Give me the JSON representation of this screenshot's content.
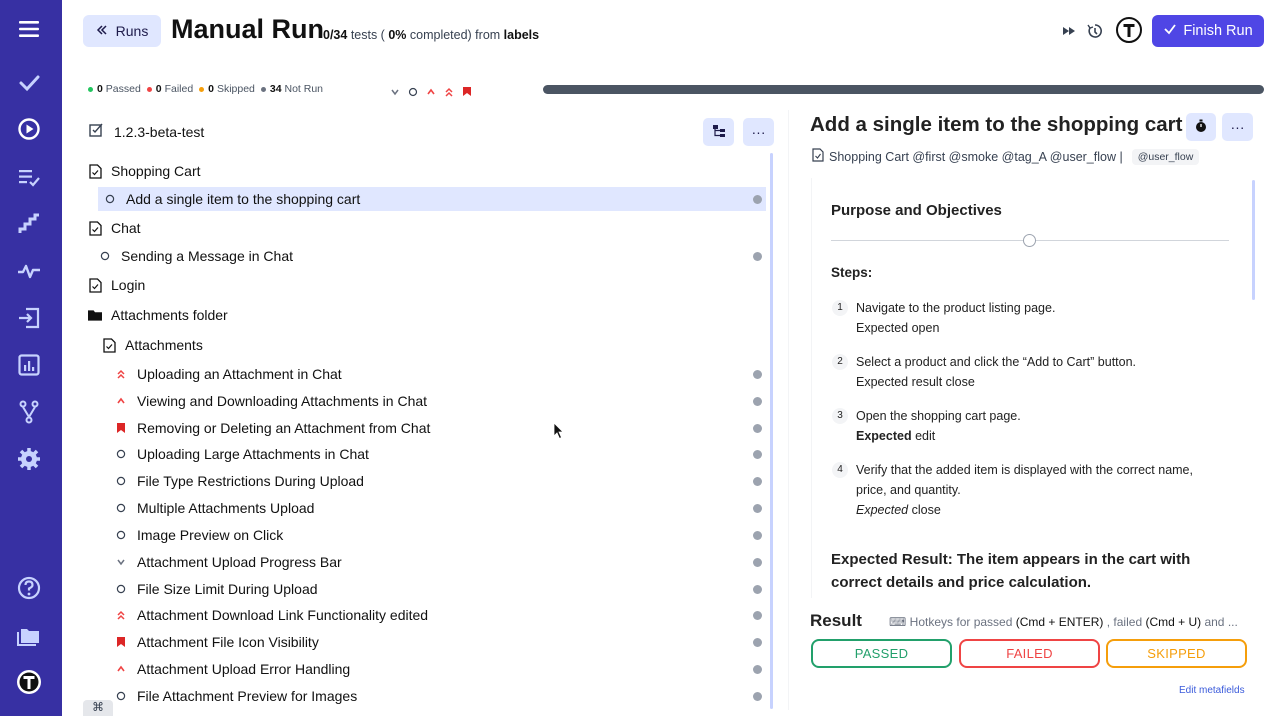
{
  "header": {
    "runs_label": "Runs",
    "title": "Manual Run",
    "subtitle_prefix": "0/34",
    "subtitle_mid": " tests ( ",
    "subtitle_pct": "0%",
    "subtitle_mid2": " completed) from ",
    "subtitle_source": "labels",
    "finish_label": "Finish Run",
    "accent": "#4f46e5"
  },
  "stats": {
    "passed_count": "0",
    "passed_label": "Passed",
    "failed_count": "0",
    "failed_label": "Failed",
    "skipped_count": "0",
    "skipped_label": "Skipped",
    "notrun_count": "34",
    "notrun_label": "Not Run",
    "colors": {
      "passed": "#22c55e",
      "failed": "#ef4444",
      "skipped": "#f59e0b",
      "notrun": "#6b7280"
    },
    "progress": 0
  },
  "tree": {
    "root_label": "1.2.3-beta-test",
    "items": [
      {
        "label": "Shopping Cart",
        "icon": "file-icon"
      },
      {
        "label": "Add a single item to the shopping cart",
        "icon": "circle-icon"
      },
      {
        "label": "Chat",
        "icon": "file-icon"
      },
      {
        "label": "Sending a Message in Chat",
        "icon": "circle-icon"
      },
      {
        "label": "Login",
        "icon": "file-icon"
      },
      {
        "label": "Attachments folder",
        "icon": "folder-icon"
      },
      {
        "label": "Attachments",
        "icon": "file-icon"
      },
      {
        "label": "Uploading an Attachment in Chat",
        "icon": "double-chevron-up-icon"
      },
      {
        "label": "Viewing and Downloading Attachments in Chat",
        "icon": "chevron-up-icon"
      },
      {
        "label": "Removing or Deleting an Attachment from Chat",
        "icon": "bookmark-icon"
      },
      {
        "label": "Uploading Large Attachments in Chat",
        "icon": "circle-icon"
      },
      {
        "label": "File Type Restrictions During Upload",
        "icon": "circle-icon"
      },
      {
        "label": "Multiple Attachments Upload",
        "icon": "circle-icon"
      },
      {
        "label": "Image Preview on Click",
        "icon": "circle-icon"
      },
      {
        "label": "Attachment Upload Progress Bar",
        "icon": "chevron-down-icon"
      },
      {
        "label": "File Size Limit During Upload",
        "icon": "circle-icon"
      },
      {
        "label": "Attachment Download Link Functionality edited",
        "icon": "double-chevron-up-icon"
      },
      {
        "label": "Attachment File Icon Visibility",
        "icon": "bookmark-icon"
      },
      {
        "label": "Attachment Upload Error Handling",
        "icon": "chevron-up-icon"
      },
      {
        "label": "File Attachment Preview for Images",
        "icon": "circle-icon"
      }
    ]
  },
  "detail": {
    "title": "Add a single item to the shopping cart",
    "tag_line": "Shopping Cart @first @smoke @tag_A @user_flow |",
    "tag_pill": "@user_flow",
    "section_title": "Purpose and Objectives",
    "steps_label": "Steps:",
    "steps": [
      {
        "num": "1",
        "line1": "Navigate to the product listing page.",
        "exp_prefix": "Expected",
        "exp_suffix": " open",
        "style": "plain"
      },
      {
        "num": "2",
        "line1": "Select a product and click the “Add to Cart” button.",
        "exp_prefix": "Expected",
        "exp_suffix": " result close",
        "style": "plain"
      },
      {
        "num": "3",
        "line1": "Open the shopping cart page.",
        "exp_prefix": "Expected",
        "exp_suffix": " edit",
        "style": "bold"
      },
      {
        "num": "4",
        "line1": "Verify that the added item is displayed with the correct name,",
        "line2": "price, and quantity.",
        "exp_prefix": "Expected",
        "exp_suffix": " close",
        "style": "italic"
      }
    ],
    "expected_label": "Expected Result:",
    "expected_text": " The item appears in the cart with correct details and price calculation."
  },
  "result": {
    "label": "Result",
    "hotkeys_a": "Hotkeys for passed ",
    "hotkeys_b": "(Cmd + ENTER)",
    "hotkeys_c": " , failed ",
    "hotkeys_d": "(Cmd + U)",
    "hotkeys_e": " and ...",
    "passed": "PASSED",
    "failed": "FAILED",
    "skipped": "SKIPPED",
    "edit_meta": "Edit metafields"
  },
  "nav": {
    "icons": [
      "menu-icon",
      "check-icon",
      "play-icon",
      "list-check-icon",
      "stairs-icon",
      "pulse-icon",
      "import-icon",
      "chart-icon",
      "branch-icon",
      "settings-icon",
      "help-icon",
      "folders-icon",
      "logo-icon"
    ]
  },
  "bottom": {
    "cmd_symbol": "⌘"
  }
}
